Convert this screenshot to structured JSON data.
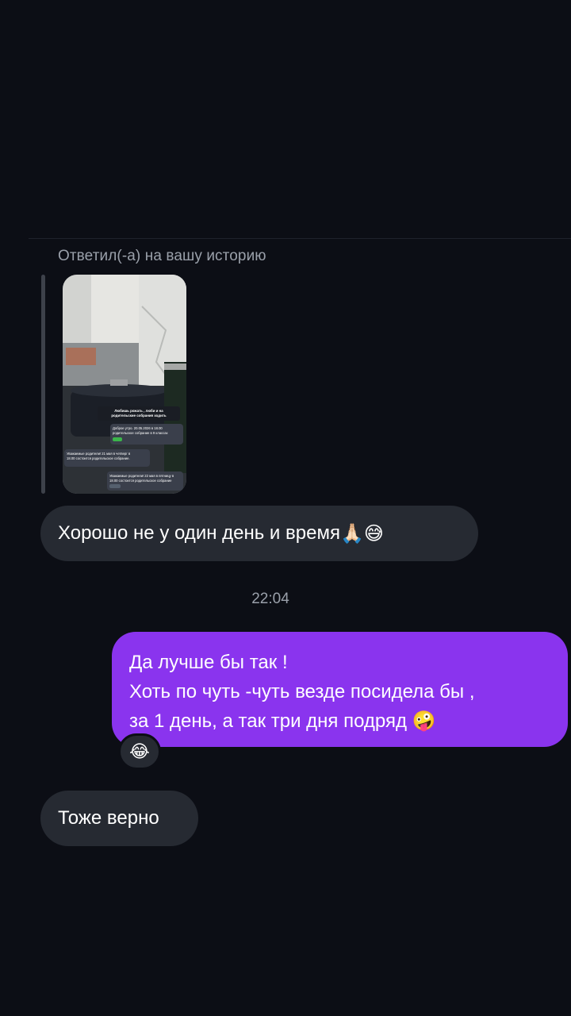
{
  "conversation": {
    "reply_caption": "Ответил(-а) на вашу историю",
    "story_preview": {
      "overlay_title": "Любишь рожать , люби и на родительские собрания ходить",
      "messages": [
        {
          "text": "Доброе утро. 20.05.2026 в 18.00 родительское собрание в 9 классах",
          "time": "07:00"
        },
        {
          "text": "Уважаемые родители! 21 мая в четверг в 18.00 состоится родительское собрание.",
          "time": "09:00"
        },
        {
          "text": "Уважаемые родители! 22 мая в пятницу в 18.00 состоится родительское собрание",
          "time": "09:00"
        }
      ]
    },
    "messages": [
      {
        "text": "Хорошо не у один день и время",
        "emoji": "🙏🏻😅"
      },
      {
        "time_separator": "22:04"
      },
      {
        "lines": [
          "Да лучше бы так !",
          "Хоть по чуть -чуть везде посидела бы ,",
          "за 1 день, а так три дня подряд"
        ],
        "emoji": "🤪",
        "reaction": "😂"
      },
      {
        "text": "Тоже верно"
      }
    ]
  },
  "colors": {
    "background": "#0c0e15",
    "incoming_bubble": "#262a32",
    "outgoing_bubble": "#8a34ee",
    "secondary_text": "#9aa0aa"
  }
}
